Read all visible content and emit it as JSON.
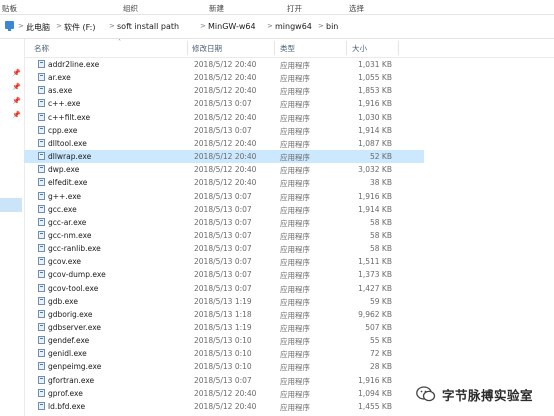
{
  "ribbon": {
    "items": [
      "贴板",
      "组织",
      "新建",
      "打开",
      "选择"
    ]
  },
  "breadcrumb": {
    "items": [
      "此电脑",
      "软件 (F:)",
      "soft install path",
      "MinGW-w64",
      "mingw64",
      "bin"
    ],
    "separator": ">"
  },
  "columns": {
    "name": "名称",
    "modified": "修改日期",
    "type": "类型",
    "size": "大小"
  },
  "files": [
    {
      "name": "addr2line.exe",
      "modified": "2018/5/12 20:40",
      "type": "应用程序",
      "size": "1,031 KB"
    },
    {
      "name": "ar.exe",
      "modified": "2018/5/12 20:40",
      "type": "应用程序",
      "size": "1,055 KB"
    },
    {
      "name": "as.exe",
      "modified": "2018/5/12 20:40",
      "type": "应用程序",
      "size": "1,853 KB"
    },
    {
      "name": "c++.exe",
      "modified": "2018/5/13 0:07",
      "type": "应用程序",
      "size": "1,916 KB"
    },
    {
      "name": "c++filt.exe",
      "modified": "2018/5/12 20:40",
      "type": "应用程序",
      "size": "1,030 KB"
    },
    {
      "name": "cpp.exe",
      "modified": "2018/5/13 0:07",
      "type": "应用程序",
      "size": "1,914 KB"
    },
    {
      "name": "dlltool.exe",
      "modified": "2018/5/12 20:40",
      "type": "应用程序",
      "size": "1,087 KB"
    },
    {
      "name": "dllwrap.exe",
      "modified": "2018/5/12 20:40",
      "type": "应用程序",
      "size": "52 KB",
      "selected": true
    },
    {
      "name": "dwp.exe",
      "modified": "2018/5/12 20:40",
      "type": "应用程序",
      "size": "3,032 KB"
    },
    {
      "name": "elfedit.exe",
      "modified": "2018/5/12 20:40",
      "type": "应用程序",
      "size": "38 KB"
    },
    {
      "name": "g++.exe",
      "modified": "2018/5/13 0:07",
      "type": "应用程序",
      "size": "1,916 KB"
    },
    {
      "name": "gcc.exe",
      "modified": "2018/5/13 0:07",
      "type": "应用程序",
      "size": "1,914 KB"
    },
    {
      "name": "gcc-ar.exe",
      "modified": "2018/5/13 0:07",
      "type": "应用程序",
      "size": "58 KB"
    },
    {
      "name": "gcc-nm.exe",
      "modified": "2018/5/13 0:07",
      "type": "应用程序",
      "size": "58 KB"
    },
    {
      "name": "gcc-ranlib.exe",
      "modified": "2018/5/13 0:07",
      "type": "应用程序",
      "size": "58 KB"
    },
    {
      "name": "gcov.exe",
      "modified": "2018/5/13 0:07",
      "type": "应用程序",
      "size": "1,511 KB"
    },
    {
      "name": "gcov-dump.exe",
      "modified": "2018/5/13 0:07",
      "type": "应用程序",
      "size": "1,373 KB"
    },
    {
      "name": "gcov-tool.exe",
      "modified": "2018/5/13 0:07",
      "type": "应用程序",
      "size": "1,427 KB"
    },
    {
      "name": "gdb.exe",
      "modified": "2018/5/13 1:19",
      "type": "应用程序",
      "size": "59 KB"
    },
    {
      "name": "gdborig.exe",
      "modified": "2018/5/13 1:18",
      "type": "应用程序",
      "size": "9,962 KB"
    },
    {
      "name": "gdbserver.exe",
      "modified": "2018/5/13 1:19",
      "type": "应用程序",
      "size": "507 KB"
    },
    {
      "name": "gendef.exe",
      "modified": "2018/5/13 0:10",
      "type": "应用程序",
      "size": "55 KB"
    },
    {
      "name": "genidl.exe",
      "modified": "2018/5/13 0:10",
      "type": "应用程序",
      "size": "72 KB"
    },
    {
      "name": "genpeimg.exe",
      "modified": "2018/5/13 0:10",
      "type": "应用程序",
      "size": "28 KB"
    },
    {
      "name": "gfortran.exe",
      "modified": "2018/5/13 0:07",
      "type": "应用程序",
      "size": "1,916 KB"
    },
    {
      "name": "gprof.exe",
      "modified": "2018/5/12 20:40",
      "type": "应用程序",
      "size": "1,094 KB"
    },
    {
      "name": "ld.bfd.exe",
      "modified": "2018/5/12 20:40",
      "type": "应用程序",
      "size": "1,455 KB"
    }
  ],
  "watermark": {
    "text": "字节脉搏实验室"
  }
}
